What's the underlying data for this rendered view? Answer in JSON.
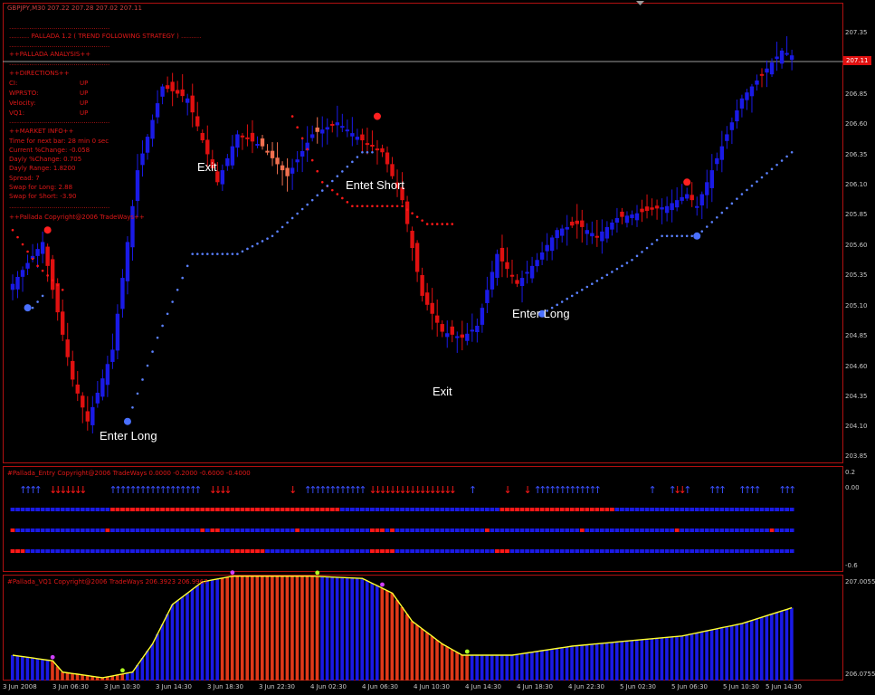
{
  "window": {
    "symbol_header": "GBPJPY,M30  207.22 207.28 207.02 207.11"
  },
  "panel": {
    "dots": "..................................................",
    "title": ".......... PALLADA 1.2 ( TREND FOLLOWING STRATEGY ) ..........",
    "analysis": "++PALLADA ANALYSIS++",
    "directions_header": "++DIRECTIONS++",
    "directions": [
      {
        "label": "CI:",
        "value": "UP"
      },
      {
        "label": "WPRSTO:",
        "value": "UP"
      },
      {
        "label": "Velocity:",
        "value": "UP"
      },
      {
        "label": "VQ1:",
        "value": "UP"
      }
    ],
    "market_header": "++MARKET INFO++",
    "market": [
      "Time for next bar: 28 min 0 sec",
      "Current %Change: -0.058",
      "Dayly %Change: 0.705",
      "Dayly Range: 1.8200",
      "Spread: 7",
      "Swap for Long: 2.88",
      "Swap for Short: -3.90"
    ],
    "copyright": "++Pallada Copyright@2006 TradeWays++"
  },
  "price_tag": "207.11",
  "annotations": {
    "exit_1": "Exit",
    "enter_short": "Entet Short",
    "enter_long_1": "Enter Long",
    "enter_long_2": "Enter Long",
    "exit_2": "Exit"
  },
  "entry_indicator": {
    "title": "#Pallada_Entry Copyright@2006 TradeWays 0.0000 -0.2000 -0.6000 -0.4000",
    "axis": [
      "0.2",
      "0.00",
      "-0.6"
    ]
  },
  "vq_indicator": {
    "title": "#Pallada_VQ1 Copyright@2006 TradeWays 206.3923 206.9967",
    "axis": [
      "207.0055",
      "206.0755"
    ]
  },
  "colors": {
    "bull": "#1a1ae6",
    "bear": "#e01010",
    "salmon": "#f07050",
    "grid": "#b01010",
    "signal_line": "#ffff30"
  },
  "chart_data": [
    {
      "type": "candlestick",
      "title": "GBPJPY,M30",
      "ylim": [
        203.85,
        207.55
      ],
      "y_ticks": [
        "207.35",
        "206.85",
        "206.60",
        "206.35",
        "206.10",
        "205.85",
        "205.60",
        "205.35",
        "205.10",
        "204.85",
        "204.60",
        "204.35",
        "204.10",
        "203.85"
      ],
      "x_ticks": [
        "3 Jun 2008",
        "3 Jun 06:30",
        "3 Jun 10:30",
        "3 Jun 14:30",
        "3 Jun 18:30",
        "3 Jun 22:30",
        "4 Jun 02:30",
        "4 Jun 06:30",
        "4 Jun 10:30",
        "4 Jun 14:30",
        "4 Jun 18:30",
        "4 Jun 22:30",
        "5 Jun 02:30",
        "5 Jun 06:30",
        "5 Jun 10:30",
        "5 Jun 14:30"
      ],
      "close_phases": [
        [
          0,
          205.2
        ],
        [
          6,
          205.55
        ],
        [
          8,
          205.15
        ],
        [
          12,
          204.4
        ],
        [
          15,
          204.05
        ],
        [
          20,
          204.65
        ],
        [
          25,
          206.15
        ],
        [
          30,
          206.85
        ],
        [
          35,
          206.75
        ],
        [
          38,
          206.4
        ],
        [
          41,
          206.05
        ],
        [
          45,
          206.45
        ],
        [
          50,
          206.35
        ],
        [
          55,
          206.1
        ],
        [
          60,
          206.45
        ],
        [
          65,
          206.55
        ],
        [
          70,
          206.4
        ],
        [
          74,
          206.3
        ],
        [
          78,
          205.9
        ],
        [
          82,
          205.1
        ],
        [
          86,
          204.8
        ],
        [
          90,
          204.75
        ],
        [
          93,
          204.85
        ],
        [
          97,
          205.45
        ],
        [
          101,
          205.2
        ],
        [
          105,
          205.4
        ],
        [
          109,
          205.65
        ],
        [
          113,
          205.7
        ],
        [
          117,
          205.6
        ],
        [
          121,
          205.75
        ],
        [
          126,
          205.8
        ],
        [
          131,
          205.85
        ],
        [
          135,
          205.95
        ],
        [
          137,
          205.85
        ],
        [
          141,
          206.25
        ],
        [
          146,
          206.75
        ],
        [
          150,
          206.95
        ],
        [
          154,
          207.15
        ],
        [
          156,
          207.11
        ]
      ],
      "red_stop_phases": [
        [
          0,
          205.65
        ],
        [
          5,
          205.35
        ],
        [
          10,
          205.15
        ],
        [
          13,
          null
        ],
        [
          55,
          null
        ],
        [
          56,
          206.6
        ],
        [
          62,
          206.05
        ],
        [
          68,
          205.85
        ],
        [
          78,
          205.85
        ],
        [
          83,
          205.7
        ],
        [
          88,
          205.7
        ],
        [
          89,
          null
        ]
      ],
      "blue_stop_phases": [
        [
          0,
          null
        ],
        [
          4,
          205.0
        ],
        [
          6,
          205.1
        ],
        [
          7,
          null
        ],
        [
          23,
          204.05
        ],
        [
          29,
          204.75
        ],
        [
          36,
          205.45
        ],
        [
          45,
          205.45
        ],
        [
          52,
          205.6
        ],
        [
          60,
          205.9
        ],
        [
          70,
          206.3
        ],
        [
          72,
          206.3
        ],
        [
          73,
          null
        ],
        [
          106,
          204.95
        ],
        [
          112,
          205.1
        ],
        [
          118,
          205.25
        ],
        [
          124,
          205.4
        ],
        [
          130,
          205.6
        ],
        [
          137,
          205.6
        ],
        [
          146,
          205.95
        ],
        [
          156,
          206.3
        ]
      ]
    },
    {
      "type": "bar",
      "title": "#Pallada_VQ1",
      "ylim": [
        206.0755,
        207.0055
      ]
    }
  ]
}
